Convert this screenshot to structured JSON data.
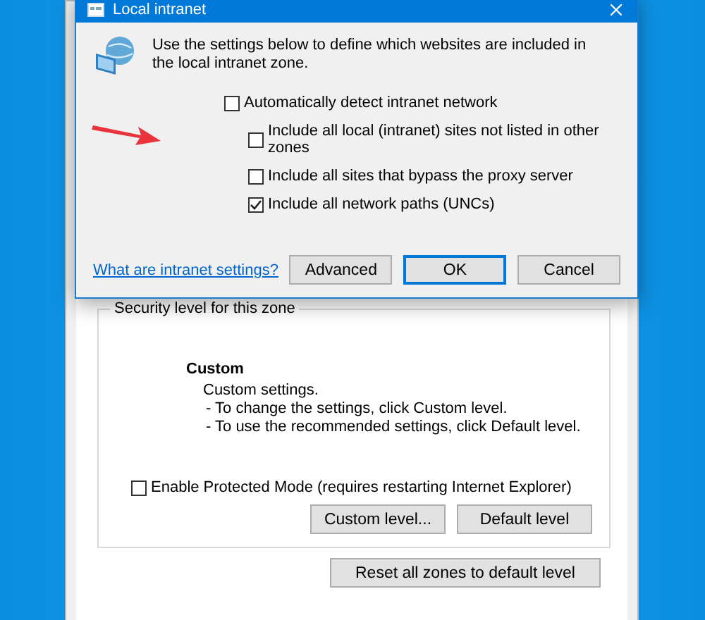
{
  "dialog": {
    "title": "Local intranet",
    "description": "Use the settings below to define which websites are included in the local intranet zone.",
    "options": [
      {
        "label": "Automatically detect intranet network",
        "checked": false,
        "children": [
          {
            "label": "Include all local (intranet) sites not listed in other zones",
            "checked": false
          },
          {
            "label": "Include all sites that bypass the proxy server",
            "checked": false
          },
          {
            "label": "Include all network paths (UNCs)",
            "checked": true
          }
        ]
      }
    ],
    "link": "What are intranet settings?",
    "buttons": [
      {
        "label": "Advanced",
        "default": false
      },
      {
        "label": "OK",
        "default": true
      },
      {
        "label": "Cancel",
        "default": false
      }
    ]
  },
  "background_window": {
    "group_label": "Security level for this zone",
    "level_name": "Custom",
    "level_lines": [
      "Custom settings.",
      "- To change the settings, click Custom level.",
      "- To use the recommended settings, click Default level."
    ],
    "protected_mode": {
      "label": "Enable Protected Mode (requires restarting Internet Explorer)",
      "checked": false
    },
    "level_buttons": [
      "Custom level...",
      "Default level"
    ],
    "reset_button": "Reset all zones to default level"
  }
}
